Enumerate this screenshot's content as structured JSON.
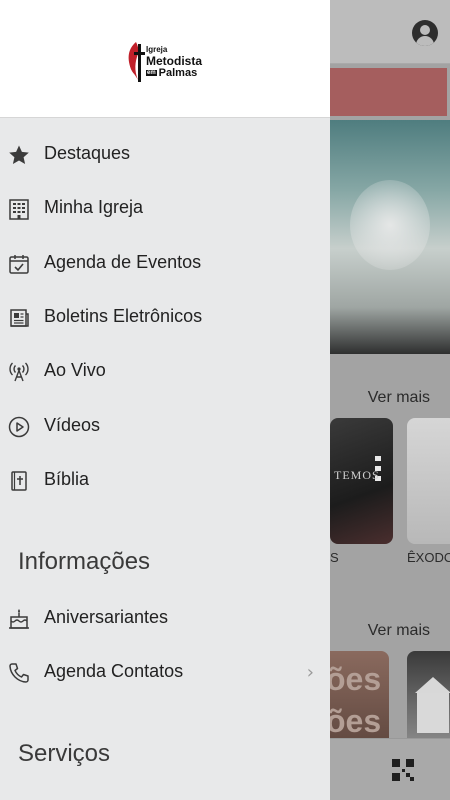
{
  "background": {
    "sections": [
      {
        "ver_mais": "Ver mais",
        "cards": [
          "S",
          "ÊXODO"
        ],
        "card_texts": {
          "stage": "TEMOS"
        }
      },
      {
        "ver_mais": "Ver mais",
        "cards": {
          "line1": "ões",
          "line2": "ões"
        }
      }
    ],
    "icons": {
      "profile": "account-circle-icon",
      "qr": "qr-code-icon"
    },
    "colors": {
      "banner": "#a55e5e"
    }
  },
  "drawer": {
    "logo": {
      "line1": "Igreja",
      "line2": "Metodista",
      "prefix": "em",
      "line3": "Palmas"
    },
    "items": [
      {
        "label": "Destaques",
        "icon": "star-icon"
      },
      {
        "label": "Minha Igreja",
        "icon": "building-icon"
      },
      {
        "label": "Agenda de Eventos",
        "icon": "calendar-check-icon"
      },
      {
        "label": "Boletins Eletrônicos",
        "icon": "newspaper-icon"
      },
      {
        "label": "Ao Vivo",
        "icon": "broadcast-icon"
      },
      {
        "label": "Vídeos",
        "icon": "play-circle-icon"
      },
      {
        "label": "Bíblia",
        "icon": "bible-icon"
      }
    ],
    "section_informacoes": "Informações",
    "info_items": [
      {
        "label": "Aniversariantes",
        "icon": "cake-icon"
      },
      {
        "label": "Agenda Contatos",
        "icon": "phone-icon",
        "chevron": "›"
      }
    ],
    "section_servicos": "Serviços"
  }
}
